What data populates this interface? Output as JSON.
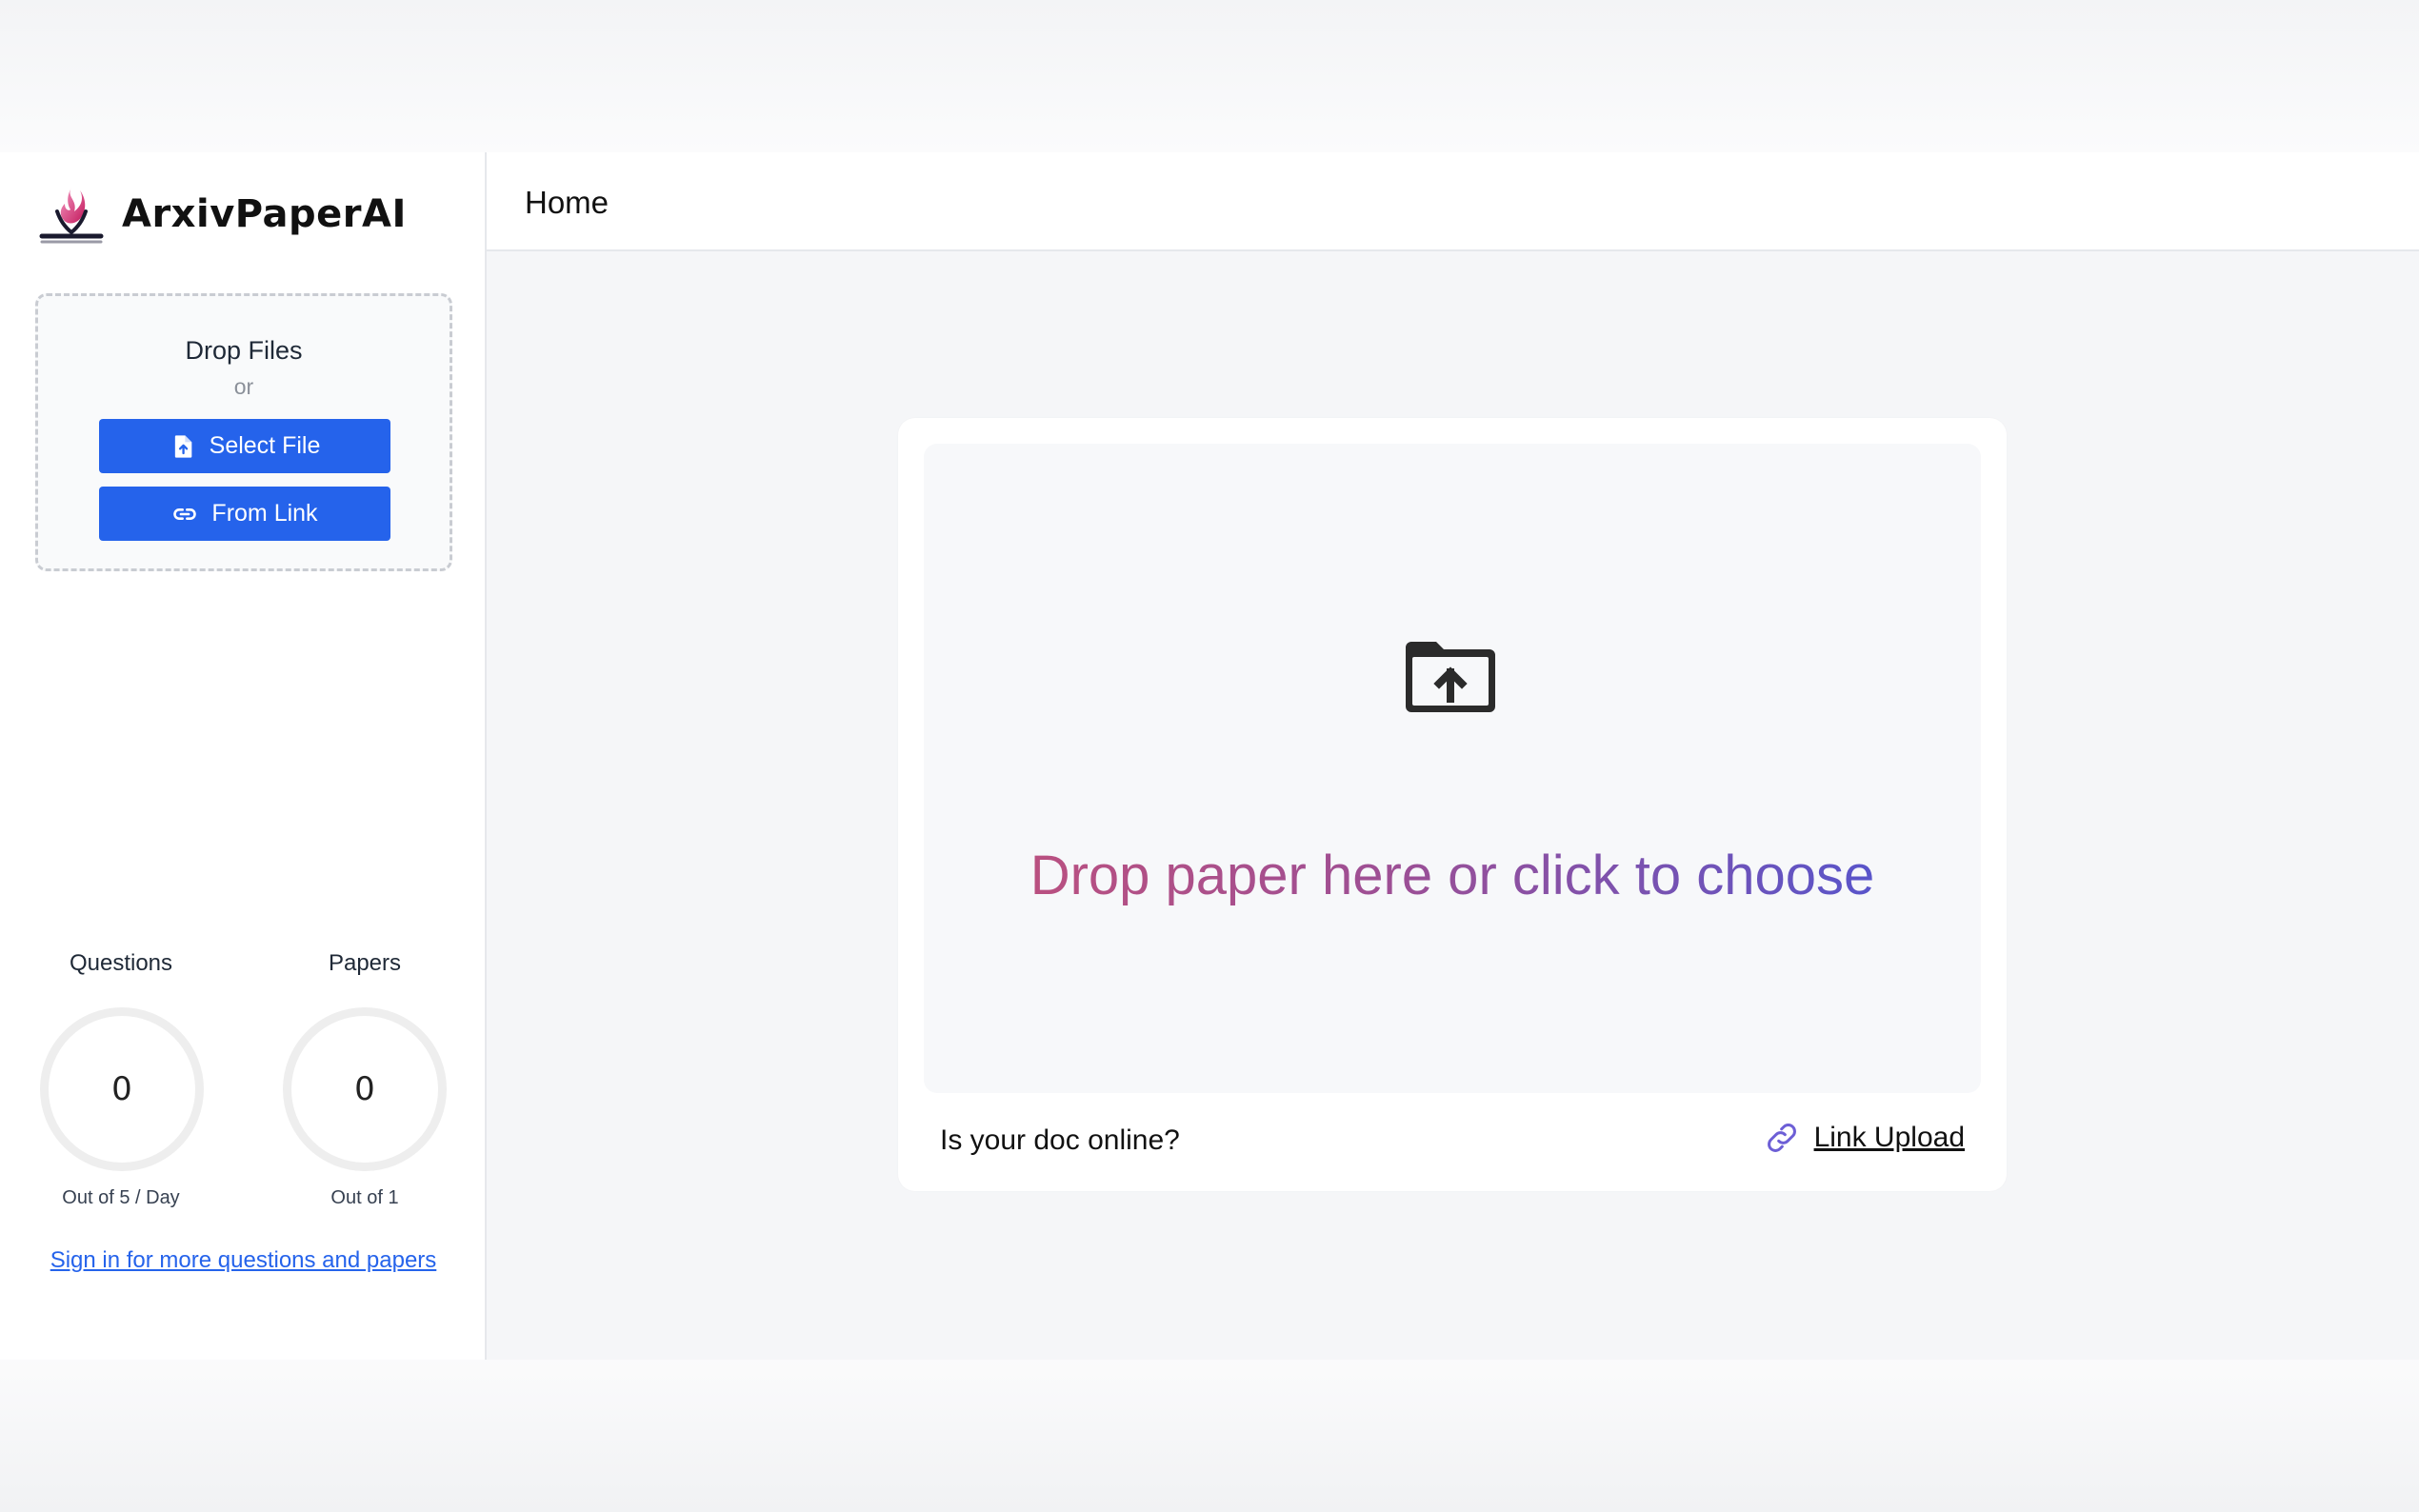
{
  "brand": {
    "name": "ArxivPaperAI",
    "logo_icon": "flame-book-logo-icon"
  },
  "sidebar": {
    "drop_title": "Drop Files",
    "drop_or": "or",
    "select_file_label": "Select File",
    "select_file_icon": "file-upload-icon",
    "from_link_label": "From Link",
    "from_link_icon": "link-icon",
    "stats": [
      {
        "label": "Questions",
        "value": "0",
        "sub": "Out of 5 / Day"
      },
      {
        "label": "Papers",
        "value": "0",
        "sub": "Out of 1"
      }
    ],
    "signin_text": "Sign in for more questions and papers"
  },
  "header": {
    "title": "Home"
  },
  "main": {
    "dropzone_icon": "folder-upload-icon",
    "dropzone_text": "Drop paper here or click to choose",
    "online_question": "Is your doc online?",
    "link_upload_label": "Link Upload",
    "link_upload_icon": "link-icon"
  },
  "colors": {
    "primary": "#2563eb",
    "gradient_start": "#c2507a",
    "gradient_end": "#4a56d6",
    "link_icon": "#6d5fd6"
  }
}
